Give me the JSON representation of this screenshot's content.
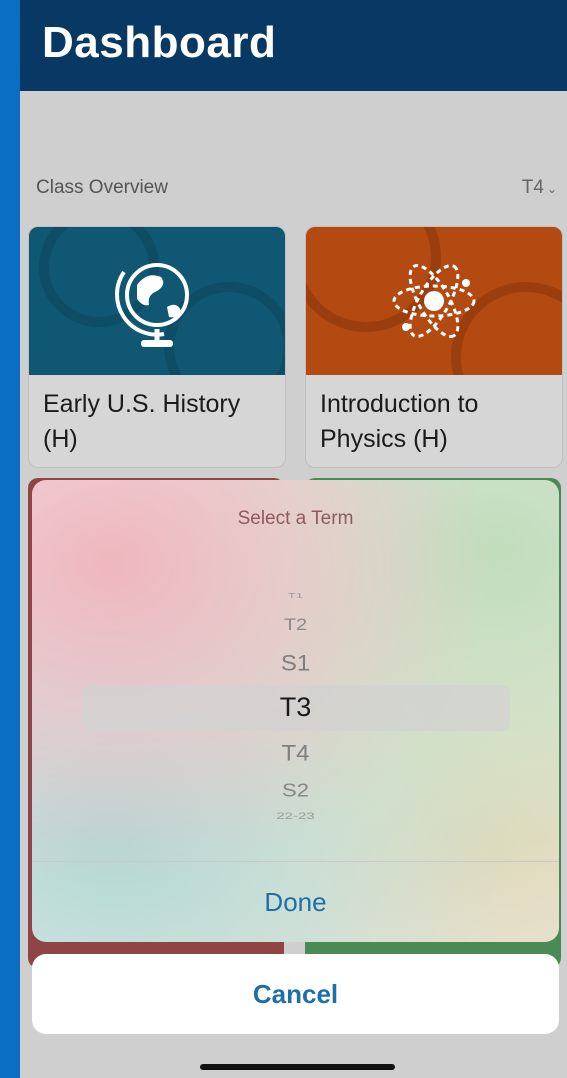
{
  "header": {
    "title": "Dashboard"
  },
  "section": {
    "title": "Class Overview",
    "term": "T4",
    "chevron_icon": "chevron-down-icon"
  },
  "cards": [
    {
      "label": "Early U.S. History (H)",
      "icon": "globe-icon",
      "color": "#0f5773"
    },
    {
      "label": "Introduction to Physics (H)",
      "icon": "atom-icon",
      "color": "#b24a12"
    }
  ],
  "picker": {
    "title": "Select a Term",
    "options": [
      "T1",
      "T2",
      "S1",
      "T3",
      "T4",
      "S2",
      "22-23"
    ],
    "selected": "T3",
    "done_label": "Done"
  },
  "cancel": {
    "label": "Cancel"
  },
  "colors": {
    "accent": "#1e6fa8",
    "header_bg": "#083964"
  }
}
